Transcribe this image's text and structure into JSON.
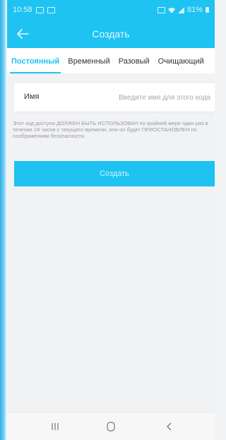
{
  "status": {
    "time": "10:58",
    "battery": "81%"
  },
  "header": {
    "title": "Создать"
  },
  "tabs": [
    {
      "label": "Постоянный",
      "active": true
    },
    {
      "label": "Временный",
      "active": false
    },
    {
      "label": "Разовый",
      "active": false
    },
    {
      "label": "Очищающий",
      "active": false
    }
  ],
  "form": {
    "name_label": "Имя",
    "name_placeholder": "Введите имя для этого кода",
    "notice": "Этот код доступа ДОЛЖЕН БЫТЬ ИСПОЛЬЗОВАН по крайней мере один раз в течение 24 часов с текущего времени, или он будет ПРИОСТАНОВЛЕН по соображениям безопасности."
  },
  "actions": {
    "create_label": "Создать"
  },
  "colors": {
    "accent": "#1ec3f2",
    "background": "#f1f2f4"
  },
  "icons": {
    "back": "arrow-left-icon",
    "recent": "recent-apps-icon",
    "home": "home-icon",
    "nav_back": "chevron-left-icon"
  }
}
